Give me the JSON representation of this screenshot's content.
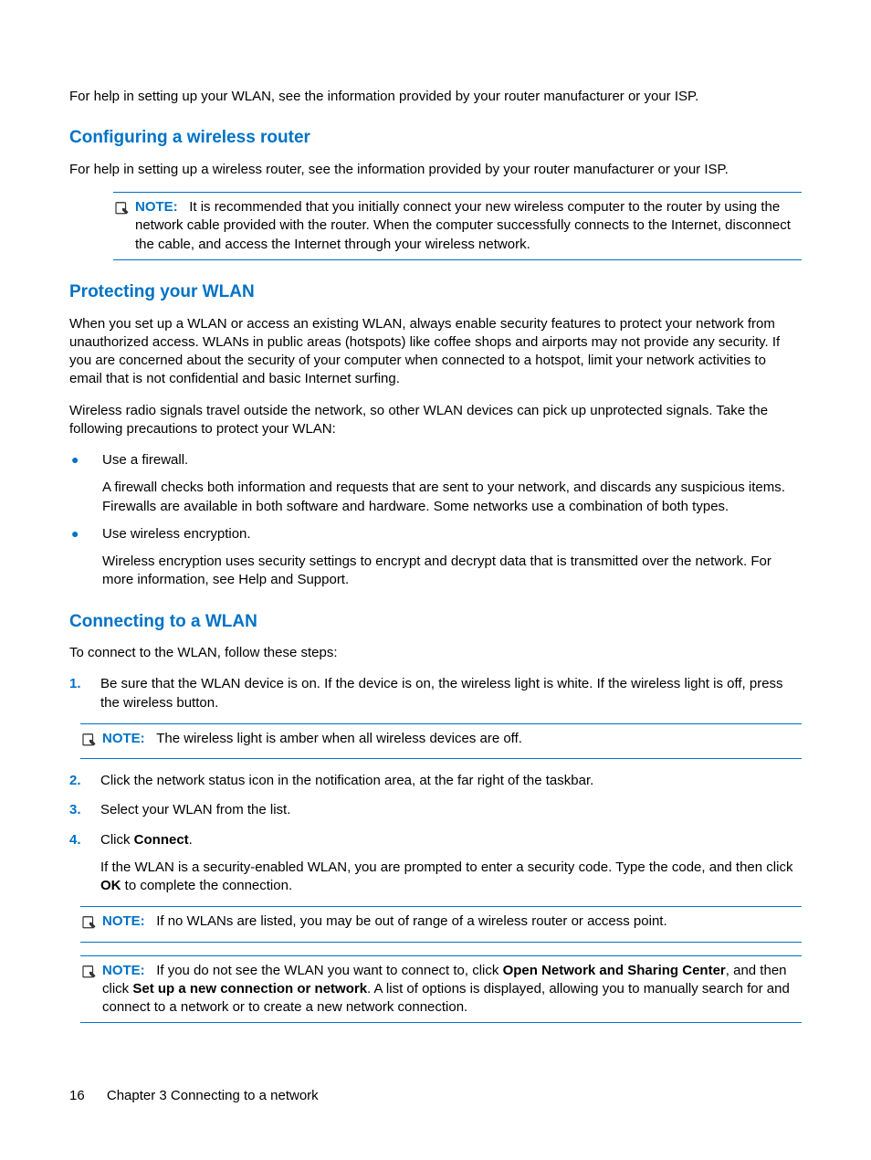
{
  "intro": "For help in setting up your WLAN, see the information provided by your router manufacturer or your ISP.",
  "sec1": {
    "heading": "Configuring a wireless router",
    "para": "For help in setting up a wireless router, see the information provided by your router manufacturer or your ISP.",
    "note_label": "NOTE:",
    "note": "It is recommended that you initially connect your new wireless computer to the router by using the network cable provided with the router. When the computer successfully connects to the Internet, disconnect the cable, and access the Internet through your wireless network."
  },
  "sec2": {
    "heading": "Protecting your WLAN",
    "para1": "When you set up a WLAN or access an existing WLAN, always enable security features to protect your network from unauthorized access. WLANs in public areas (hotspots) like coffee shops and airports may not provide any security. If you are concerned about the security of your computer when connected to a hotspot, limit your network activities to email that is not confidential and basic Internet surfing.",
    "para2": "Wireless radio signals travel outside the network, so other WLAN devices can pick up unprotected signals. Take the following precautions to protect your WLAN:",
    "b1_title": "Use a firewall.",
    "b1_body": "A firewall checks both information and requests that are sent to your network, and discards any suspicious items. Firewalls are available in both software and hardware. Some networks use a combination of both types.",
    "b2_title": "Use wireless encryption.",
    "b2_body": "Wireless encryption uses security settings to encrypt and decrypt data that is transmitted over the network. For more information, see Help and Support."
  },
  "sec3": {
    "heading": "Connecting to a WLAN",
    "intro": "To connect to the WLAN, follow these steps:",
    "s1num": "1.",
    "s1": "Be sure that the WLAN device is on. If the device is on, the wireless light is white. If the wireless light is off, press the wireless button.",
    "note1_label": "NOTE:",
    "note1": "The wireless light is amber when all wireless devices are off.",
    "s2num": "2.",
    "s2": "Click the network status icon in the notification area, at the far right of the taskbar.",
    "s3num": "3.",
    "s3": "Select your WLAN from the list.",
    "s4num": "4.",
    "s4_pre": "Click ",
    "s4_bold": "Connect",
    "s4_post": ".",
    "s4_extra_pre": "If the WLAN is a security-enabled WLAN, you are prompted to enter a security code. Type the code, and then click ",
    "s4_extra_bold": "OK",
    "s4_extra_post": " to complete the connection.",
    "note2_label": "NOTE:",
    "note2": "If no WLANs are listed, you may be out of range of a wireless router or access point.",
    "note3_label": "NOTE:",
    "note3_pre": "If you do not see the WLAN you want to connect to, click ",
    "note3_b1": "Open Network and Sharing Center",
    "note3_mid": ", and then click ",
    "note3_b2": "Set up a new connection or network",
    "note3_post": ". A list of options is displayed, allowing you to manually search for and connect to a network or to create a new network connection."
  },
  "footer": {
    "pagenum": "16",
    "chapter": "Chapter 3   Connecting to a network"
  }
}
